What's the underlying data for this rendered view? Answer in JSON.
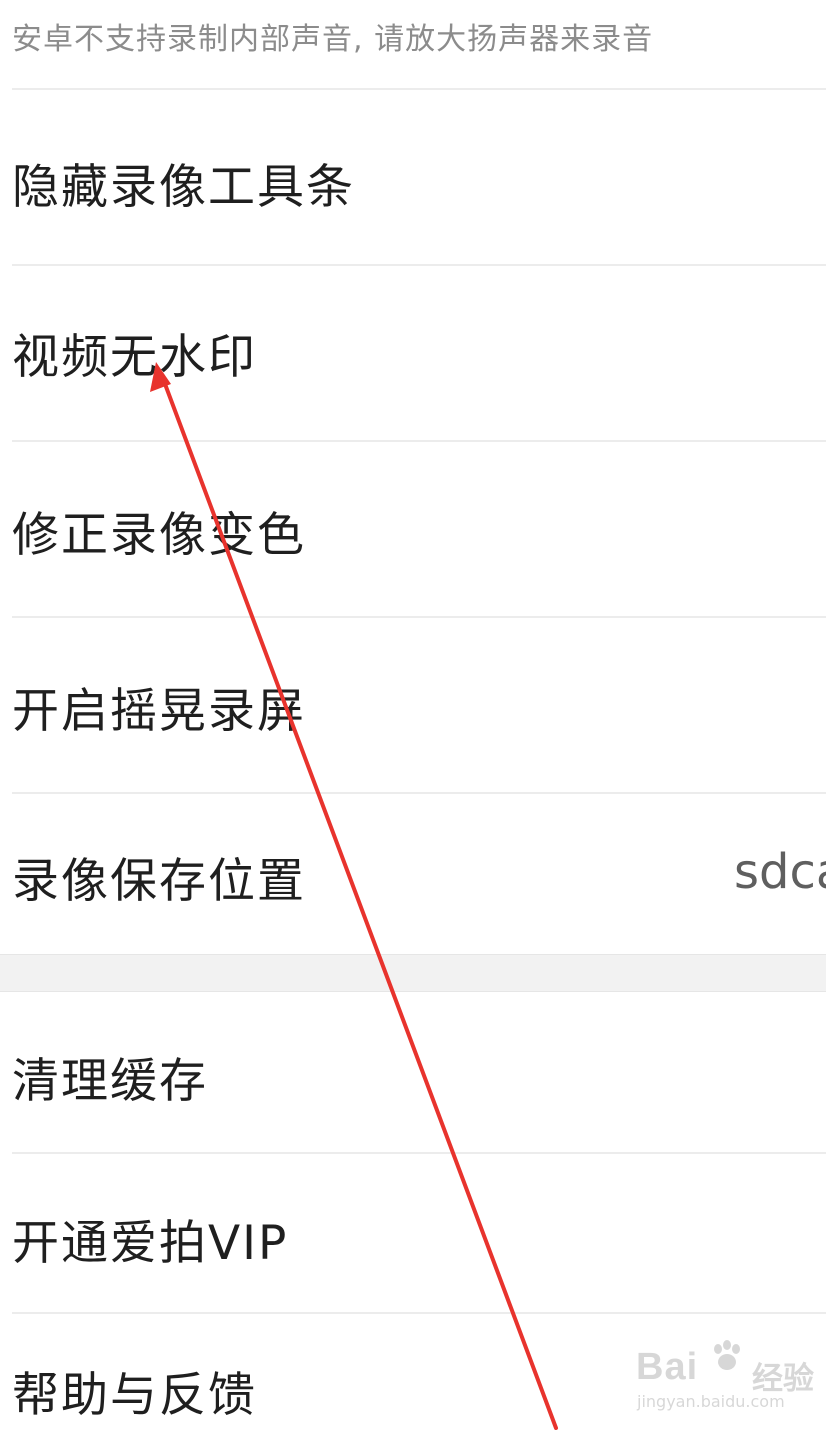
{
  "note": "安卓不支持录制内部声音, 请放大扬声器来录音",
  "settings": {
    "hide_toolbar": "隐藏录像工具条",
    "no_watermark": "视频无水印",
    "fix_color": "修正录像变色",
    "shake_record": "开启摇晃录屏",
    "save_location": "录像保存位置",
    "save_location_value": "sdca",
    "clear_cache": "清理缓存",
    "vip": "开通爱拍VIP",
    "help_feedback": "帮助与反馈"
  },
  "watermark": {
    "brand": "Bai",
    "brand_suffix": "经验",
    "url": "jingyan.baidu.com"
  },
  "colors": {
    "arrow": "#e8332d",
    "text": "#1f1f1f",
    "note": "#8c8c8c",
    "divider": "#ececec",
    "section_gap": "#f2f2f2"
  }
}
